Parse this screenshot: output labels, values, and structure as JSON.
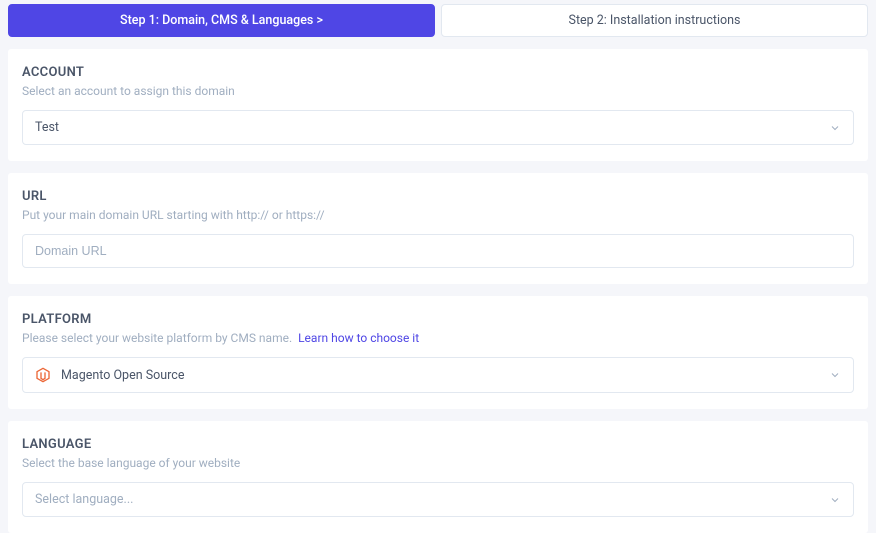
{
  "steps": {
    "step1": "Step 1: Domain, CMS & Languages  >",
    "step2": "Step 2: Installation instructions"
  },
  "account": {
    "title": "ACCOUNT",
    "subtitle": "Select an account to assign this domain",
    "selected": "Test"
  },
  "url": {
    "title": "URL",
    "subtitle": "Put your main domain URL starting with http:// or https://",
    "placeholder": "Domain URL",
    "value": ""
  },
  "platform": {
    "title": "PLATFORM",
    "subtitle": "Please select your website platform by CMS name.",
    "learn_link": "Learn how to choose it",
    "icon": "magento-icon",
    "selected": "Magento Open Source"
  },
  "language": {
    "title": "LANGUAGE",
    "subtitle": "Select the base language of your website",
    "placeholder": "Select language..."
  }
}
